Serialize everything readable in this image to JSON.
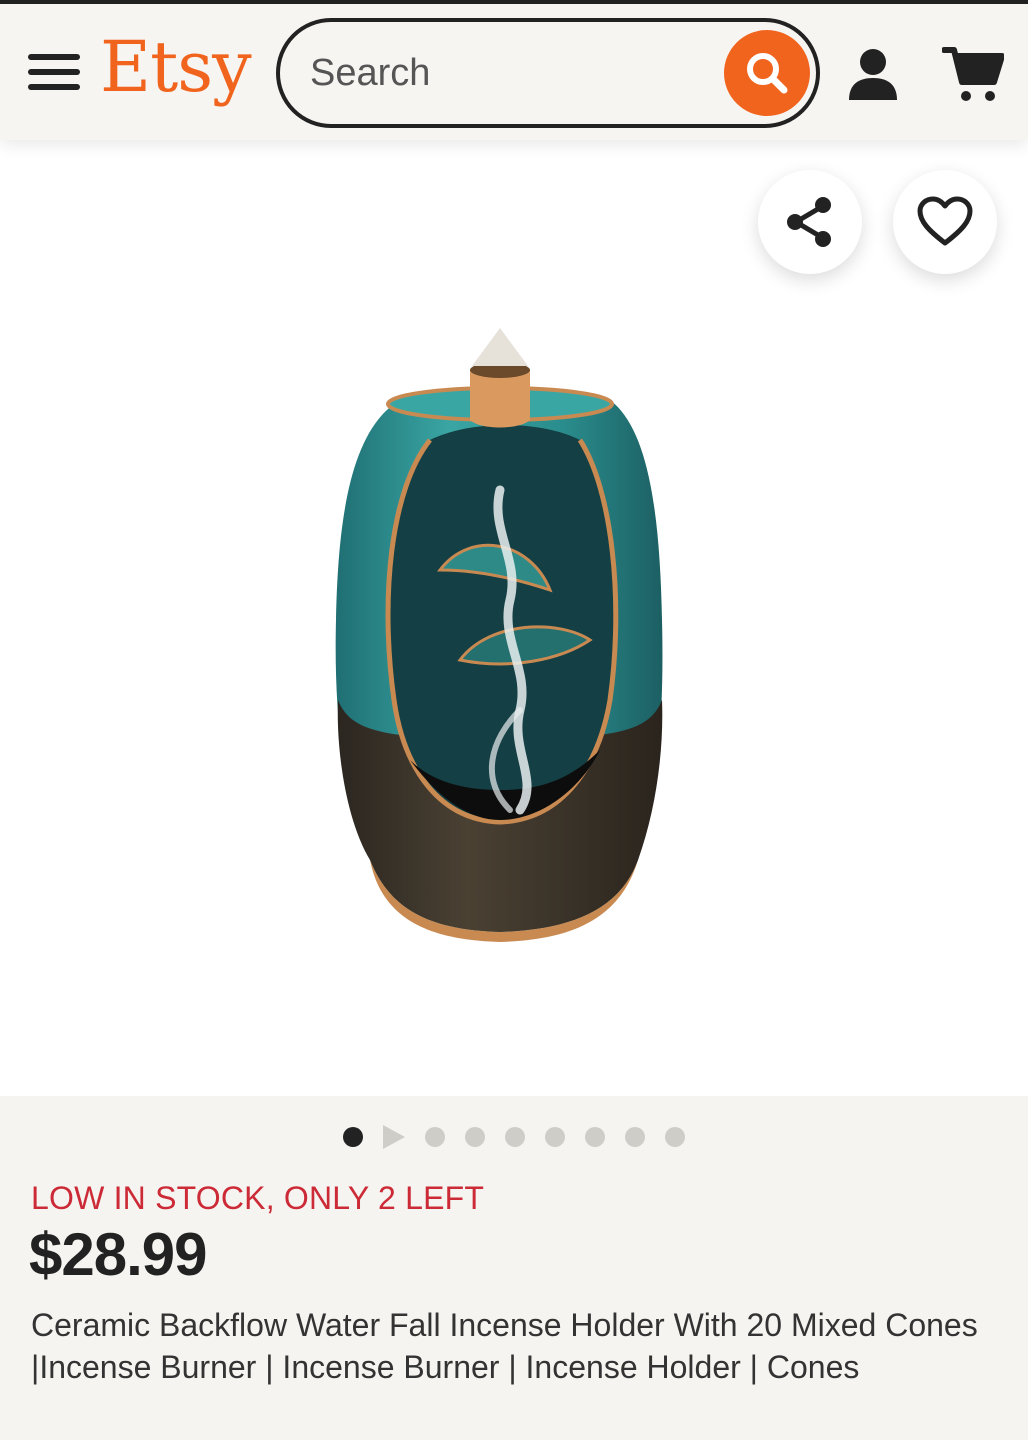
{
  "header": {
    "logo": "Etsy",
    "search_placeholder": "Search"
  },
  "product": {
    "stock_notice": "LOW IN STOCK, ONLY 2 LEFT",
    "price": "$28.99",
    "title": "Ceramic Backflow Water Fall Incense Holder With 20 Mixed Cones |Incense Burner | Incense Burner | Incense Holder | Cones"
  },
  "carousel": {
    "total_items": 9,
    "active_index": 0,
    "second_is_video": true
  },
  "icons": {
    "menu": "hamburger-menu-icon",
    "search": "search-icon",
    "account": "account-icon",
    "cart": "cart-icon",
    "share": "share-icon",
    "favorite": "heart-icon"
  },
  "colors": {
    "brand": "#f1641e",
    "stock_warning": "#cc2a36",
    "text": "#222222"
  }
}
